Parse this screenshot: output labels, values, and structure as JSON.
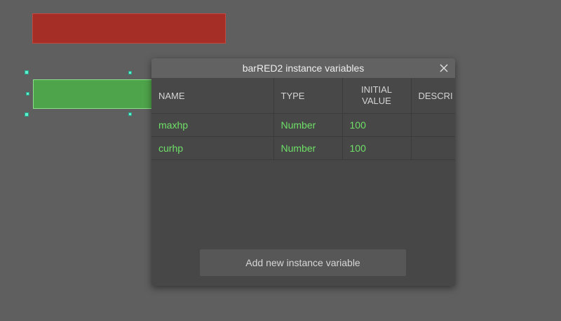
{
  "dialog": {
    "title": "barRED2 instance variables",
    "close_icon": "close-icon",
    "columns": [
      "NAME",
      "TYPE",
      "INITIAL VALUE",
      "DESCRI"
    ],
    "rows": [
      {
        "name": "maxhp",
        "type": "Number",
        "initial": "100",
        "description": ""
      },
      {
        "name": "curhp",
        "type": "Number",
        "initial": "100",
        "description": ""
      }
    ],
    "add_button_label": "Add new instance variable"
  },
  "colors": {
    "canvas_background": "#5f5f5f",
    "red_bar": "#a52f26",
    "green_bar": "#4ea44a",
    "selection_handle": "#5cf0cf",
    "variable_text": "#6ee067"
  }
}
